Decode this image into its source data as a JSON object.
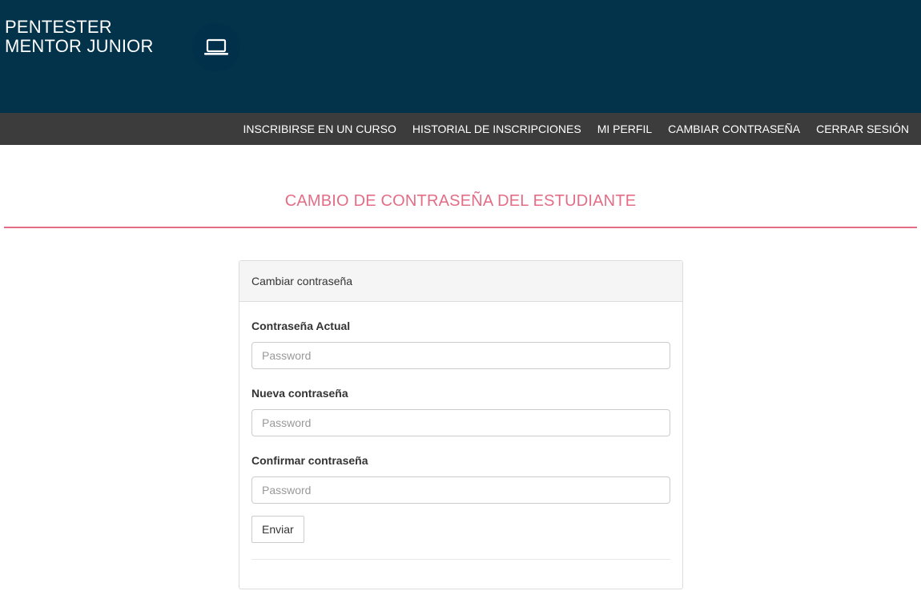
{
  "brand": {
    "line1": "PENTESTER",
    "line2": "MENTOR JUNIOR",
    "icon": "laptop-icon"
  },
  "nav": {
    "items": [
      {
        "label": "INSCRIBIRSE EN UN CURSO"
      },
      {
        "label": "HISTORIAL DE INSCRIPCIONES"
      },
      {
        "label": "MI PERFIL"
      },
      {
        "label": "CAMBIAR CONTRASEÑA"
      },
      {
        "label": "CERRAR SESIÓN"
      }
    ]
  },
  "page": {
    "title": "CAMBIO DE CONTRASEÑA DEL ESTUDIANTE"
  },
  "form": {
    "header": "Cambiar contraseña",
    "current": {
      "label": "Contraseña Actual",
      "placeholder": "Password",
      "value": ""
    },
    "new": {
      "label": "Nueva contraseña",
      "placeholder": "Password",
      "value": ""
    },
    "confirm": {
      "label": "Confirmar contraseña",
      "placeholder": "Password",
      "value": ""
    },
    "submit_label": "Enviar"
  },
  "colors": {
    "header_bg": "#02334b",
    "nav_bg": "#3c3c3c",
    "accent": "#e46d86"
  }
}
